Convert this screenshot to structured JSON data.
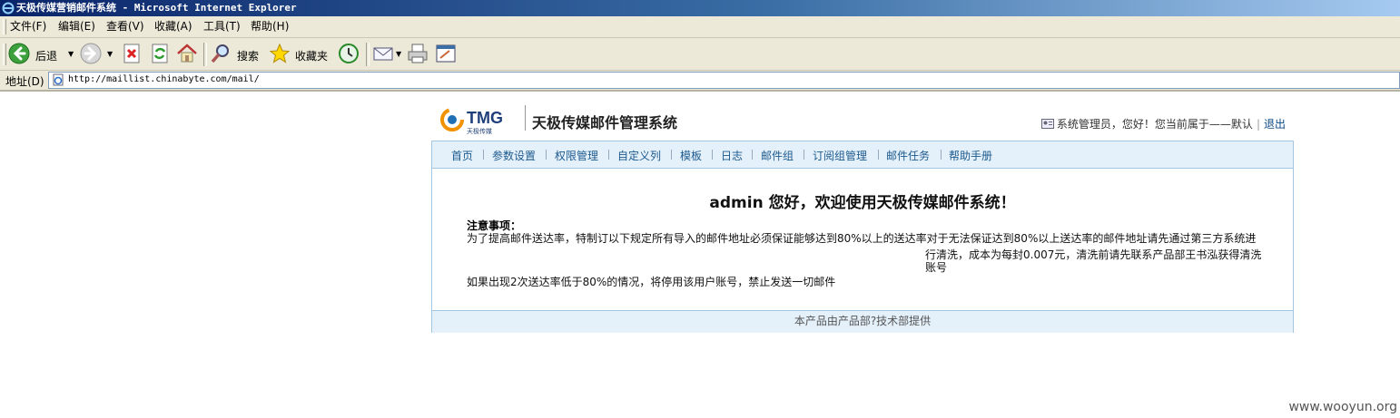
{
  "window": {
    "title": "天极传媒营销邮件系统 - Microsoft Internet Explorer"
  },
  "menubar": {
    "items": [
      "文件(F)",
      "编辑(E)",
      "查看(V)",
      "收藏(A)",
      "工具(T)",
      "帮助(H)"
    ]
  },
  "toolbar": {
    "back_label": "后退",
    "search_label": "搜索",
    "favorites_label": "收藏夹"
  },
  "addressbar": {
    "label": "地址(D)",
    "url": "http://maillist.chinabyte.com/mail/"
  },
  "header": {
    "logo_text": "TMG",
    "logo_subtext": "天极传媒",
    "system_title": "天极传媒邮件管理系统",
    "user_text": "系统管理员，您好！您当前属于——默认",
    "logout_label": "退出"
  },
  "nav": {
    "items": [
      "首页",
      "参数设置",
      "权限管理",
      "自定义列",
      "模板",
      "日志",
      "邮件组",
      "订阅组管理",
      "邮件任务",
      "帮助手册"
    ]
  },
  "content": {
    "welcome": "admin 您好，欢迎使用天极传媒邮件系统！",
    "notice_title": "注意事项：",
    "notice_line1": "为了提高邮件送达率，特制订以下规定所有导入的邮件地址必须保证能够达到80%以上的送达率对于无法保证达到80%以上送达率的邮件地址请先通过第三方系统进",
    "notice_line2": "行清洗，成本为每封0.007元，清洗前请先联系产品部王书泓获得清洗",
    "notice_line3": "账号",
    "notice_line4": "如果出现2次送达率低于80%的情况，将停用该用户账号，禁止发送一切邮件"
  },
  "footer": {
    "text": "本产品由产品部?技术部提供"
  },
  "watermark": "www.wooyun.org"
}
